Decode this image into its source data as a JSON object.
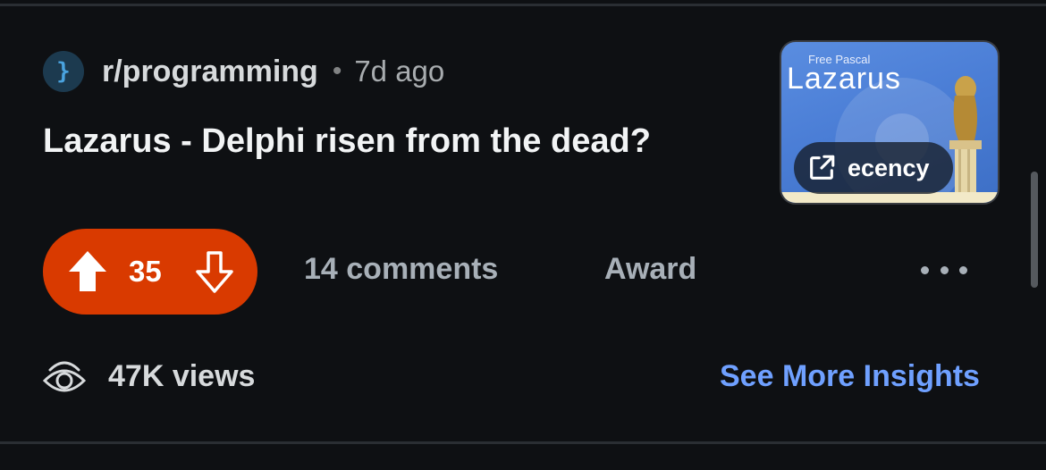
{
  "post": {
    "subreddit": "r/programming",
    "separator": "•",
    "age": "7d ago",
    "title": "Lazarus - Delphi risen from the dead?",
    "thumbnail": {
      "small_text": "Free Pascal",
      "big_text": "Lazarus",
      "link_label": "ecency",
      "link_icon": "external-link-icon"
    },
    "subreddit_icon_glyph": "}"
  },
  "actions": {
    "vote_count": "35",
    "comments": "14 comments",
    "award": "Award",
    "more_icon": "ellipsis-icon"
  },
  "insights": {
    "views": "47K views",
    "see_more": "See More Insights"
  },
  "colors": {
    "vote_pill": "#d93a00",
    "link_accent": "#6fa0ff",
    "background": "#0e1013"
  }
}
